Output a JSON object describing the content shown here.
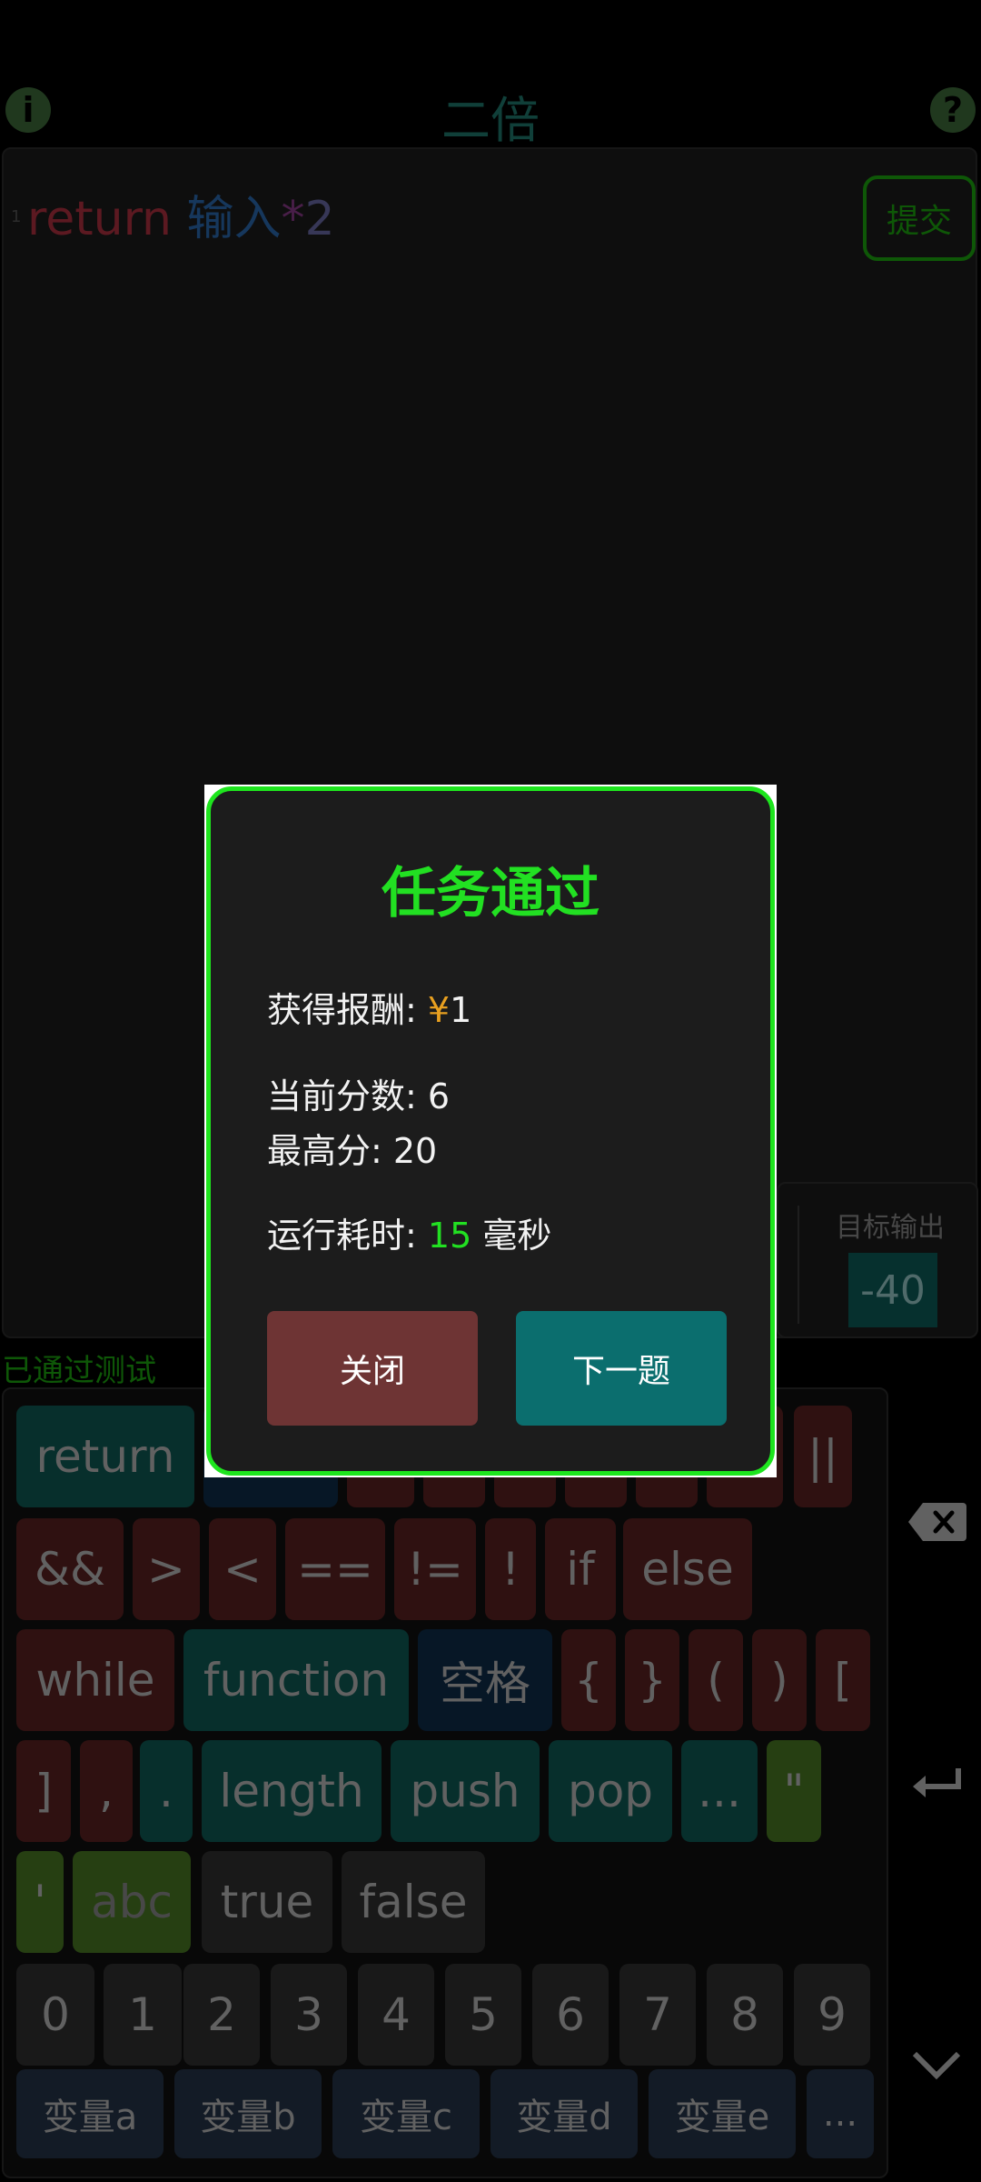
{
  "header": {
    "title": "二倍",
    "info_icon": "i",
    "help_icon": "?"
  },
  "editor": {
    "line_number": "1",
    "code": {
      "keyword": "return",
      "variable": "输入",
      "operator": "*",
      "number": "2"
    },
    "submit_label": "提交"
  },
  "output": {
    "label": "目标输出",
    "value": "-40"
  },
  "status": {
    "passed_text": "已通过测试"
  },
  "keyboard": {
    "row1": [
      "return",
      "||"
    ],
    "row2": [
      "&&",
      ">",
      "<",
      "==",
      "!=",
      "!",
      "if",
      "else"
    ],
    "row3": [
      "while",
      "function",
      "空格",
      "{",
      "}",
      "(",
      ")",
      "["
    ],
    "row4": [
      "]",
      ",",
      ".",
      "length",
      "push",
      "pop",
      "...",
      "\""
    ],
    "row5": [
      "'",
      "abc",
      "true",
      "false"
    ],
    "digits": [
      "0",
      "1",
      "2",
      "3",
      "4",
      "5",
      "6",
      "7",
      "8",
      "9"
    ],
    "variables": [
      "变量a",
      "变量b",
      "变量c",
      "变量d",
      "变量e",
      "..."
    ],
    "side": {
      "backspace_icon": "backspace-icon",
      "enter_icon": "enter-icon",
      "collapse_icon": "chevron-down-icon"
    }
  },
  "dialog": {
    "title": "任务通过",
    "reward_label": "获得报酬: ",
    "reward_currency": "¥",
    "reward_value": "1",
    "current_score": "当前分数: 6",
    "high_score": "最高分: 20",
    "runtime_label": "运行耗时: ",
    "runtime_value": "15",
    "runtime_unit": " 毫秒",
    "close_label": "关闭",
    "next_label": "下一题"
  }
}
